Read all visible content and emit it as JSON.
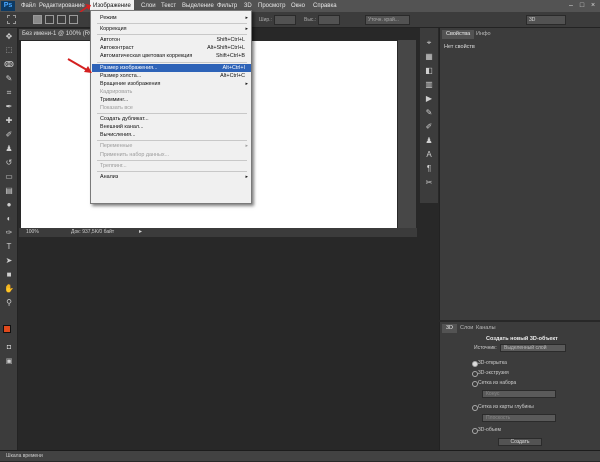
{
  "app": {
    "logo": "Ps"
  },
  "menubar": {
    "items": [
      "Файл",
      "Редактирование",
      "Изображение",
      "Слои",
      "Текст",
      "Выделение",
      "Фильтр",
      "3D",
      "Просмотр",
      "Окно",
      "Справка"
    ]
  },
  "optionsbar": {
    "width_label": "Шир.:",
    "height_label": "Выс.:",
    "refine_label": "Уточн. край...",
    "workspace": "3D"
  },
  "document": {
    "tab_title": "Без имени-1 @ 100% (RGB/8)",
    "zoom": "100%",
    "doc_info": "Док: 937,5K/0 байт"
  },
  "timeline": {
    "label": "Шкала времени"
  },
  "panels": {
    "top_tabs": [
      "Свойства",
      "Инфо"
    ],
    "top_empty": "Нет свойств",
    "bottom_tabs": [
      "3D",
      "Слои",
      "Каналы"
    ],
    "create_title": "Создать новый 3D-объект",
    "source_label": "Источник:",
    "source_value": "Выделенный слой",
    "options": [
      "3D-открытка",
      "3D-экструзия",
      "Сетка из набора",
      "Сетка из карты глубины",
      "3D-объем"
    ],
    "preset_dd": "Конус",
    "depth_dd": "Плоскость",
    "create_button": "Создать"
  },
  "menu": {
    "items": [
      {
        "label": "Режим",
        "shortcut": "",
        "submenu": true,
        "disabled": false
      },
      {
        "sep": true
      },
      {
        "label": "Коррекция",
        "shortcut": "",
        "submenu": true,
        "disabled": false
      },
      {
        "sep": true
      },
      {
        "label": "Автотон",
        "shortcut": "Shift+Ctrl+L",
        "submenu": false,
        "disabled": false
      },
      {
        "label": "Автоконтраст",
        "shortcut": "Alt+Shift+Ctrl+L",
        "submenu": false,
        "disabled": false
      },
      {
        "label": "Автоматическая цветовая коррекция",
        "shortcut": "Shift+Ctrl+B",
        "submenu": false,
        "disabled": false
      },
      {
        "sep": true
      },
      {
        "label": "Размер изображения...",
        "shortcut": "Alt+Ctrl+I",
        "submenu": false,
        "disabled": false,
        "highlight": true
      },
      {
        "label": "Размер холста...",
        "shortcut": "Alt+Ctrl+C",
        "submenu": false,
        "disabled": false
      },
      {
        "label": "Вращение изображения",
        "shortcut": "",
        "submenu": true,
        "disabled": false
      },
      {
        "label": "Кадрировать",
        "shortcut": "",
        "submenu": false,
        "disabled": true
      },
      {
        "label": "Тримминг...",
        "shortcut": "",
        "submenu": false,
        "disabled": false
      },
      {
        "label": "Показать все",
        "shortcut": "",
        "submenu": false,
        "disabled": true
      },
      {
        "sep": true
      },
      {
        "label": "Создать дубликат...",
        "shortcut": "",
        "submenu": false,
        "disabled": false
      },
      {
        "label": "Внешний канал...",
        "shortcut": "",
        "submenu": false,
        "disabled": false
      },
      {
        "label": "Вычисления...",
        "shortcut": "",
        "submenu": false,
        "disabled": false
      },
      {
        "sep": true
      },
      {
        "label": "Переменные",
        "shortcut": "",
        "submenu": true,
        "disabled": true
      },
      {
        "label": "Применить набор данных...",
        "shortcut": "",
        "submenu": false,
        "disabled": true
      },
      {
        "sep": true
      },
      {
        "label": "Треппинг...",
        "shortcut": "",
        "submenu": false,
        "disabled": true
      },
      {
        "sep": true
      },
      {
        "label": "Анализ",
        "shortcut": "",
        "submenu": true,
        "disabled": false
      }
    ]
  },
  "colors": {
    "accent": "#2e63b8",
    "arrow": "#d42020",
    "foreground_swatch": "#e0491c"
  }
}
